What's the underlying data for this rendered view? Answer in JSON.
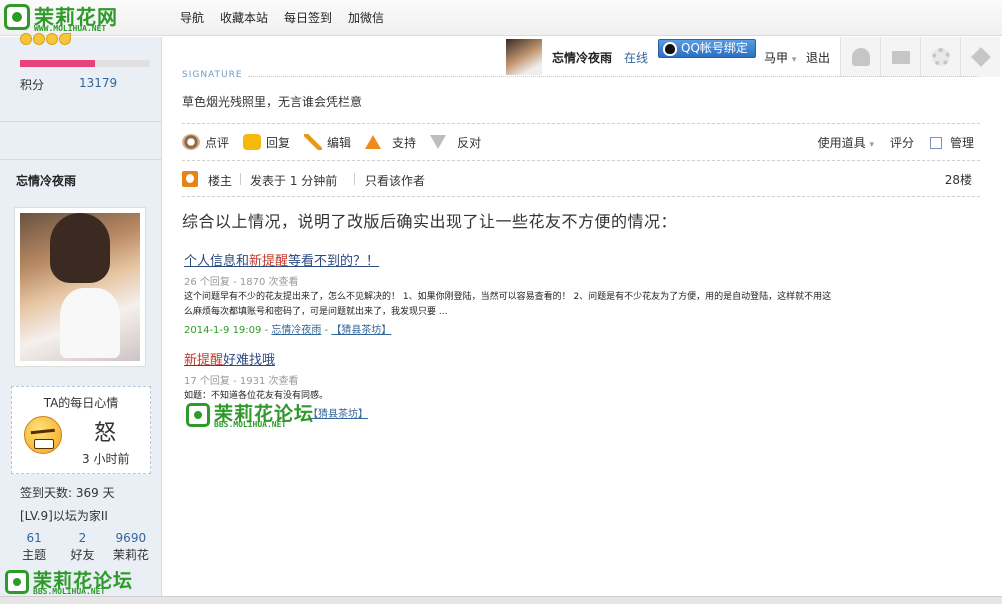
{
  "site": {
    "logo_title": "茉莉花网",
    "logo_sub": "WWW.MOLIHUA.NET"
  },
  "nav": [
    "导航",
    "收藏本站",
    "每日签到",
    "加微信"
  ],
  "sidebar": {
    "score_label": "积分",
    "score_value": "13179",
    "score_progress": 0.58,
    "username": "忘情冷夜雨",
    "mood_title": "TA的每日心情",
    "mood_word": "怒",
    "mood_time": "3 小时前",
    "sign_days": "签到天数: 369 天",
    "level": "[LV.9]以坛为家II",
    "stats": [
      {
        "num": "61",
        "label": "主题"
      },
      {
        "num": "2",
        "label": "好友"
      },
      {
        "num": "9690",
        "label": "茉莉花"
      }
    ]
  },
  "userbar": {
    "name": "忘情冷夜雨",
    "status": "在线",
    "qq_button": "QQ帐号绑定",
    "user_menu": "马甲",
    "logout": "退出",
    "tools": [
      "user-icon",
      "mail-icon",
      "gear-icon",
      "move-icon"
    ]
  },
  "post": {
    "signature_label": "SIGNATURE",
    "signature": "草色烟光残照里，无言谁会凭栏意",
    "actions": [
      {
        "label": "点评",
        "icon": "rate-icon"
      },
      {
        "label": "回复",
        "icon": "reply-icon"
      },
      {
        "label": "编辑",
        "icon": "edit-icon"
      },
      {
        "label": "支持",
        "icon": "support-icon"
      },
      {
        "label": "反对",
        "icon": "oppose-icon"
      }
    ],
    "right_tools": {
      "tools": "使用道具",
      "rate": "评分",
      "manage": "管理"
    },
    "owner_label": "楼主",
    "posted": "发表于  1 分钟前",
    "only_author": "只看该作者",
    "floor": "28楼",
    "title": "综合以上情况，说明了改版后确实出现了让一些花友不方便的情况：",
    "items": [
      {
        "title_a": "个人信息和",
        "title_red": "新提醒",
        "title_b": "等看不到的？！",
        "meta": "26 个回复  -  1870 次查看",
        "body": "这个问题早有不少的花友提出来了，怎么不见解决的！  1、如果你刚登陆，当然可以容易查看的！  2、问题是有不少花友为了方便，用的是自动登陆，这样就不用这么麻烦每次都填账号和密码了，可是问题就出来了，我发现只要  ...",
        "date": "2014-1-9 19:09",
        "author": "忘情冷夜雨",
        "forum": "【猜县茶坊】"
      },
      {
        "title_a": "",
        "title_red": "新提醒",
        "title_b": "好难找哦",
        "meta": "17 个回复  -  1931 次查看",
        "body": "如题：不知道各位花友有没有同感。",
        "date": "",
        "author": "",
        "forum": "【猜县茶坊】"
      }
    ],
    "watermark_title": "茉莉花论坛",
    "watermark_sub": "BBS.MOLIHUA.NET"
  },
  "colors": {
    "brand_green": "#2e9a2a",
    "link_blue": "#336699",
    "progress_pink": "#e8427a"
  }
}
